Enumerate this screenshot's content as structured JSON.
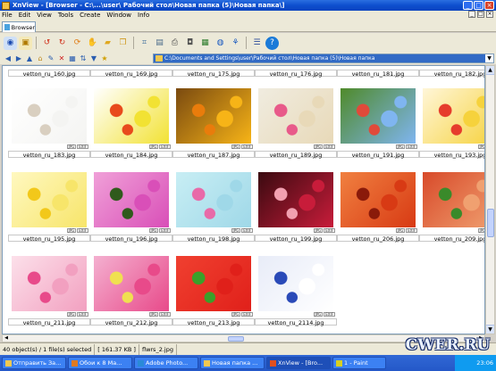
{
  "window": {
    "title": "XnView - [Browser - C:\\...\\user\\ Рабочий стол\\Новая папка (5)\\Новая папка\\]",
    "controls": [
      "_",
      "□",
      "×"
    ]
  },
  "menu": [
    "File",
    "Edit",
    "View",
    "Tools",
    "Create",
    "Window",
    "Info"
  ],
  "tab": {
    "label": "Browser"
  },
  "address": {
    "path": "C:\\Documents and Settings\\user\\Рабочий стол\\Новая папка (5)\\Новая папка"
  },
  "top_row_labels": [
    "vetton_ru_160.jpg",
    "vetton_ru_169.jpg",
    "vetton_ru_175.jpg",
    "vetton_ru_176.jpg",
    "vetton_ru_181.jpg",
    "vetton_ru_182.jpg"
  ],
  "badge_text": {
    "a": "JPG",
    "b": "EXIF"
  },
  "thumbs": [
    {
      "label": "vetton_ru_183.jpg",
      "colors": [
        "#f4f4f2",
        "#d9cfc0",
        "#ffffff"
      ]
    },
    {
      "label": "vetton_ru_184.jpg",
      "colors": [
        "#f2e233",
        "#e84a1c",
        "#ffffff"
      ]
    },
    {
      "label": "vetton_ru_187.jpg",
      "colors": [
        "#f7b417",
        "#e97c0b",
        "#7a4a10"
      ]
    },
    {
      "label": "vetton_ru_189.jpg",
      "colors": [
        "#e8d9b8",
        "#e85a8a",
        "#f0ece0"
      ]
    },
    {
      "label": "vetton_ru_191.jpg",
      "colors": [
        "#7fb5f0",
        "#e04a3a",
        "#4f8a2a"
      ]
    },
    {
      "label": "vetton_ru_193.jpg",
      "colors": [
        "#f6d23c",
        "#e63c2c",
        "#fff6d8"
      ]
    },
    {
      "label": "vetton_ru_195.jpg",
      "colors": [
        "#f7e56a",
        "#f2c81a",
        "#fff8c0"
      ]
    },
    {
      "label": "vetton_ru_196.jpg",
      "colors": [
        "#d94fb8",
        "#2f5a1c",
        "#f0a0d8"
      ]
    },
    {
      "label": "vetton_ru_198.jpg",
      "colors": [
        "#9fd8e8",
        "#e86aa8",
        "#c8eef4"
      ]
    },
    {
      "label": "vetton_ru_199.jpg",
      "colors": [
        "#c81c3a",
        "#f2a0b0",
        "#3a0a10"
      ]
    },
    {
      "label": "vetton_ru_206.jpg",
      "colors": [
        "#d83a14",
        "#8a1a0a",
        "#f08040"
      ]
    },
    {
      "label": "vetton_ru_209.jpg",
      "colors": [
        "#f0a070",
        "#3a8a2a",
        "#d84a2a"
      ]
    },
    {
      "label": "vetton_ru_211.jpg",
      "colors": [
        "#f2a0c0",
        "#e84a8a",
        "#fce0ea"
      ]
    },
    {
      "label": "vetton_ru_212.jpg",
      "colors": [
        "#e84a8a",
        "#f0e050",
        "#f4b0d0"
      ]
    },
    {
      "label": "vetton_ru_213.jpg",
      "colors": [
        "#e0201a",
        "#3aa02a",
        "#f04030"
      ]
    },
    {
      "label": "vetton_ru_2114.jpg",
      "colors": [
        "#ffffff",
        "#2a4ab8",
        "#e8ecf8"
      ]
    }
  ],
  "status": {
    "count": "40 object(s) / 1 file(s) selected",
    "size": "[ 161.37 KB ]",
    "file": "flwrs_2.jpg"
  },
  "taskbar": {
    "tasks": [
      "Отправить За...",
      "Обои к 8 Ма...",
      "Adobe Photo...",
      "Новая папка ...",
      "XnView - [Bro...",
      "1 - Paint"
    ],
    "time": "23:06"
  },
  "watermark": "CWER.RU"
}
